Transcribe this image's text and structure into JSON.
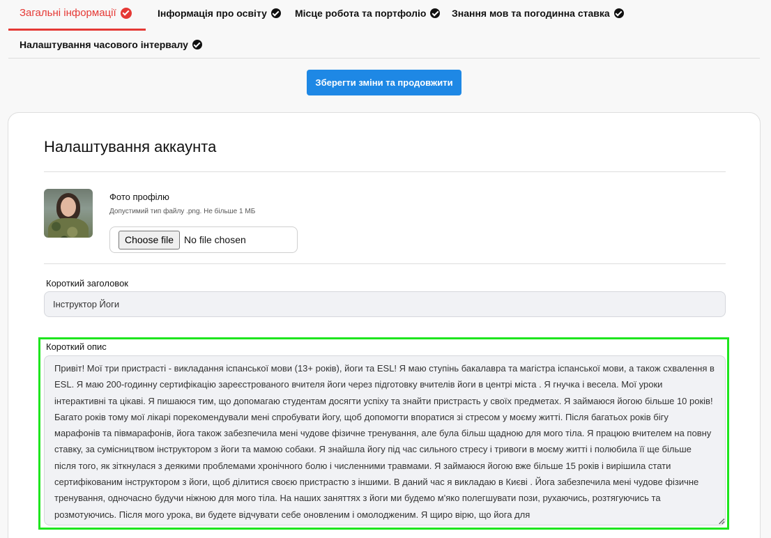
{
  "tabs": [
    {
      "label": "Загальні інформації",
      "active": true
    },
    {
      "label": "Інформація про освіту",
      "active": false
    },
    {
      "label": "Місце робота та портфоліо",
      "active": false
    },
    {
      "label": "Знання мов та погодинна ставка",
      "active": false
    },
    {
      "label": "Налаштування часового інтервалу",
      "active": false
    }
  ],
  "save_button": "Зберегти зміни та продовжити",
  "card": {
    "title": "Налаштування аккаунта",
    "photo": {
      "label": "Фото профілю",
      "hint": "Допустимий тип файлу .png. Не більше 1 МБ",
      "choose_label": "Choose file",
      "file_status": "No file chosen"
    },
    "headline": {
      "label": "Короткий заголовок",
      "value": "Інструктор Йоги"
    },
    "description": {
      "label": "Короткий опис",
      "value": "Привіт! Мої три пристрасті - викладання іспанської мови (13+ років), йоги та ESL! Я маю ступінь бакалавра та магістра іспанської мови, а також схвалення в ESL. Я маю 200-годинну сертифікацію зареєстрованого вчителя йоги через підготовку вчителів йоги в центрі міста . Я гнучка і весела. Мої уроки інтерактивні та цікаві. Я пишаюся тим, що допомагаю студентам досягти успіху та знайти пристрасть у своїх предметах. Я займаюся йогою більше 10 років! Багато років тому мої лікарі порекомендували мені спробувати йогу, щоб допомогти впоратися зі стресом у моєму житті. Після багатьох років бігу марафонів та півмарафонів, йога також забезпечила мені чудове фізичне тренування, але була більш щадною для мого тіла. Я працюю вчителем на повну ставку, за сумісництвом інструктором з йоги та мамою собаки. Я знайшла йогу під час сильного стресу і тривоги в моєму житті і полюбила її ще більше після того, як зіткнулася з деякими проблемами хронічного болю і численними травмами. Я займаюся йогою вже більше 15 років і вирішила стати сертифікованим інструктором з йоги, щоб ділитися своєю пристрастю з іншими. В даний час я викладаю в Києві . Йога забезпечила мені чудове фізичне тренування, одночасно будучи ніжною для мого тіла. На наших заняттях з йоги ми будемо м'яко полегшувати пози, рухаючись, розтягуючись та розмотуючись. Після мого урока, ви будете відчувати себе оновленим і омолодженим. Я щиро вірю, що йога для"
    }
  },
  "colors": {
    "accent": "#e53935",
    "primary_button": "#1e88e5",
    "highlight": "#1ee51e"
  }
}
